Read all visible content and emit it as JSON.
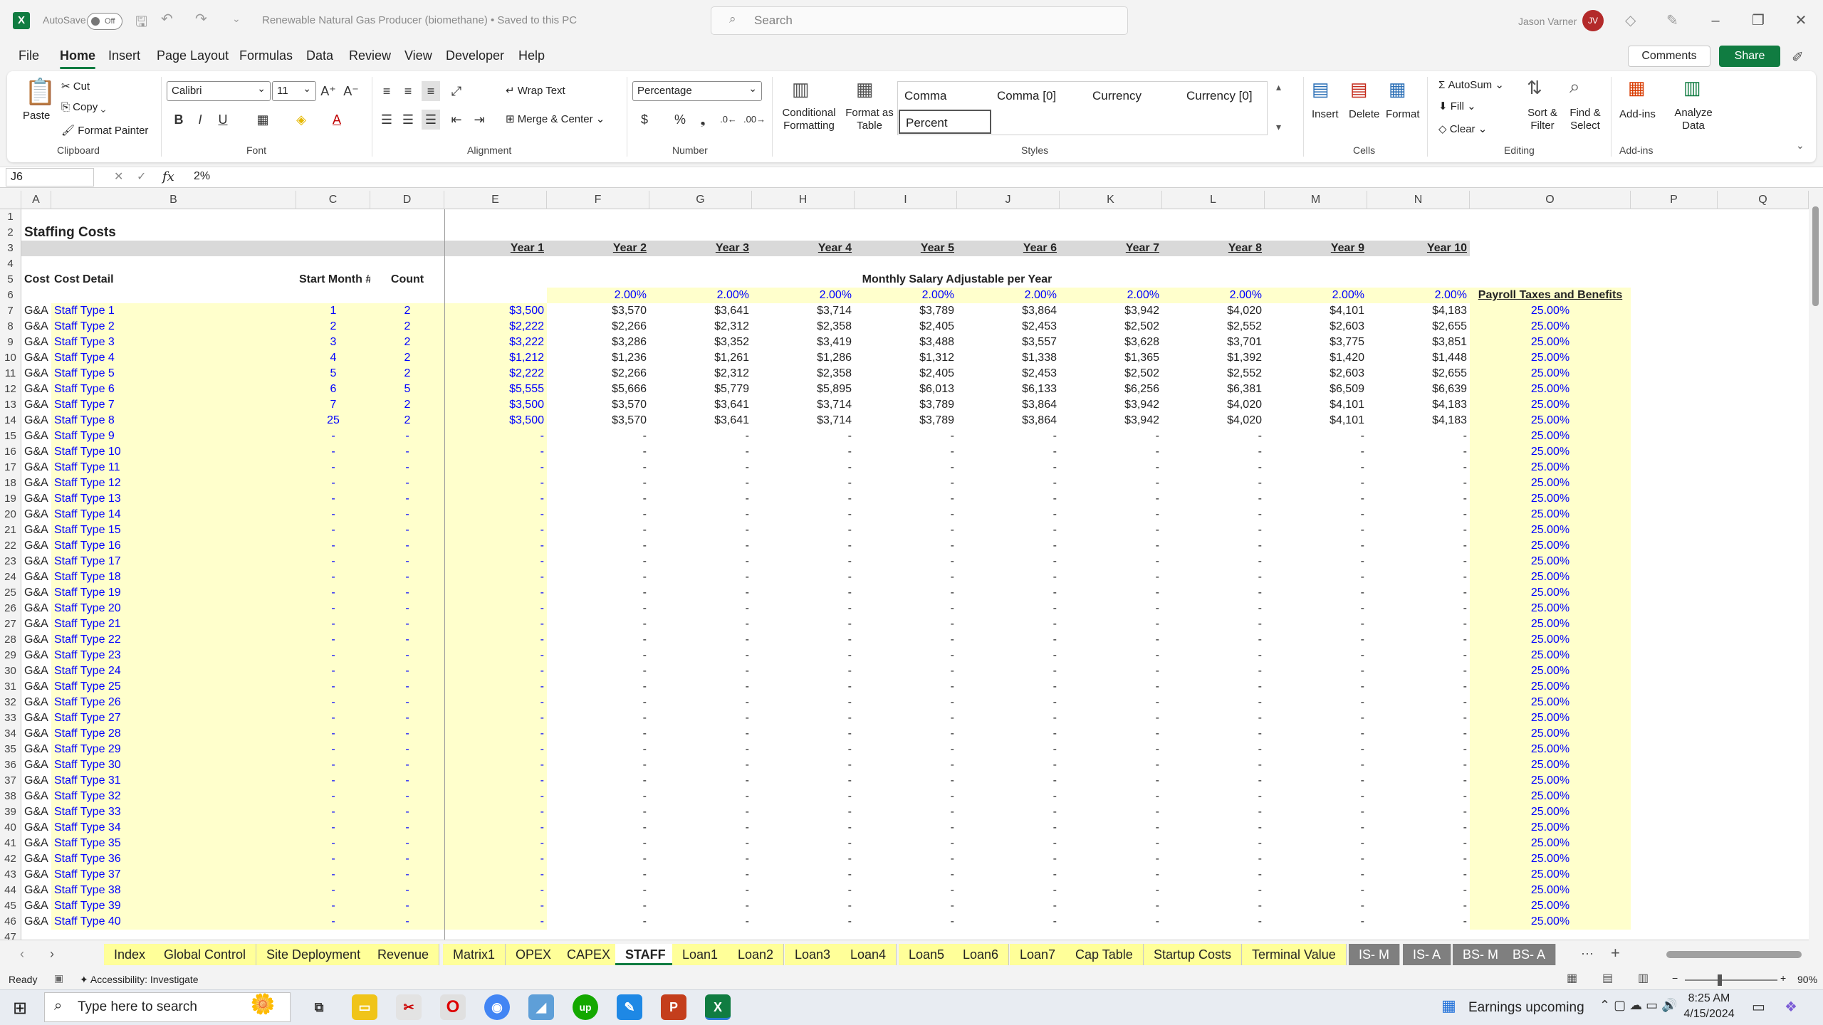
{
  "title_bar": {
    "autosave_label": "AutoSave",
    "autosave_state": "Off",
    "doc_title": "Renewable Natural Gas Producer (biomethane) • Saved to this PC",
    "search_placeholder": "Search",
    "user_name": "Jason Varner",
    "user_initials": "JV"
  },
  "menu": {
    "items": [
      "File",
      "Home",
      "Insert",
      "Page Layout",
      "Formulas",
      "Data",
      "Review",
      "View",
      "Developer",
      "Help"
    ],
    "active": "Home",
    "comments": "Comments",
    "share": "Share"
  },
  "ribbon": {
    "clipboard": {
      "paste": "Paste",
      "cut": "Cut",
      "copy": "Copy",
      "format_painter": "Format Painter",
      "label": "Clipboard"
    },
    "font": {
      "name": "Calibri",
      "size": "11",
      "label": "Font"
    },
    "alignment": {
      "wrap": "Wrap Text",
      "merge": "Merge & Center",
      "label": "Alignment"
    },
    "number": {
      "format": "Percentage",
      "label": "Number"
    },
    "styles": {
      "conditional": "Conditional Formatting",
      "format_table": "Format as Table",
      "cells": [
        "Comma",
        "Comma [0]",
        "Currency",
        "Currency [0]",
        "Percent"
      ],
      "label": "Styles"
    },
    "cells": {
      "insert": "Insert",
      "delete": "Delete",
      "format": "Format",
      "label": "Cells"
    },
    "editing": {
      "autosum": "AutoSum",
      "fill": "Fill",
      "clear": "Clear",
      "sort": "Sort & Filter",
      "find": "Find & Select",
      "label": "Editing"
    },
    "addins": {
      "addins": "Add-ins",
      "analyze": "Analyze Data",
      "label": "Add-ins"
    }
  },
  "formula_bar": {
    "name_box": "J6",
    "formula": "2%"
  },
  "columns": [
    "A",
    "B",
    "C",
    "D",
    "E",
    "F",
    "G",
    "H",
    "I",
    "J",
    "K",
    "L",
    "M",
    "N",
    "O",
    "P",
    "Q"
  ],
  "sheet": {
    "title": "Staffing Costs",
    "years": [
      "Year 1",
      "Year 2",
      "Year 3",
      "Year 4",
      "Year 5",
      "Year 6",
      "Year 7",
      "Year 8",
      "Year 9",
      "Year 10"
    ],
    "hdr_cost_type": "Cost Type",
    "hdr_cost_detail": "Cost Detail",
    "hdr_start_month": "Start Month #",
    "hdr_count": "Count",
    "hdr_salary": "Monthly Salary Adjustable per Year",
    "hdr_payroll": "Payroll Taxes and Benefits",
    "growth": "2.00%",
    "staff_rows": [
      {
        "type": "G&A",
        "detail": "Staff Type 1",
        "start": "1",
        "count": "2",
        "vals": [
          "$3,500",
          "$3,570",
          "$3,641",
          "$3,714",
          "$3,789",
          "$3,864",
          "$3,942",
          "$4,020",
          "$4,101",
          "$4,183"
        ]
      },
      {
        "type": "G&A",
        "detail": "Staff Type 2",
        "start": "2",
        "count": "2",
        "vals": [
          "$2,222",
          "$2,266",
          "$2,312",
          "$2,358",
          "$2,405",
          "$2,453",
          "$2,502",
          "$2,552",
          "$2,603",
          "$2,655"
        ]
      },
      {
        "type": "G&A",
        "detail": "Staff Type 3",
        "start": "3",
        "count": "2",
        "vals": [
          "$3,222",
          "$3,286",
          "$3,352",
          "$3,419",
          "$3,488",
          "$3,557",
          "$3,628",
          "$3,701",
          "$3,775",
          "$3,851"
        ]
      },
      {
        "type": "G&A",
        "detail": "Staff Type 4",
        "start": "4",
        "count": "2",
        "vals": [
          "$1,212",
          "$1,236",
          "$1,261",
          "$1,286",
          "$1,312",
          "$1,338",
          "$1,365",
          "$1,392",
          "$1,420",
          "$1,448"
        ]
      },
      {
        "type": "G&A",
        "detail": "Staff Type 5",
        "start": "5",
        "count": "2",
        "vals": [
          "$2,222",
          "$2,266",
          "$2,312",
          "$2,358",
          "$2,405",
          "$2,453",
          "$2,502",
          "$2,552",
          "$2,603",
          "$2,655"
        ]
      },
      {
        "type": "G&A",
        "detail": "Staff Type 6",
        "start": "6",
        "count": "5",
        "vals": [
          "$5,555",
          "$5,666",
          "$5,779",
          "$5,895",
          "$6,013",
          "$6,133",
          "$6,256",
          "$6,381",
          "$6,509",
          "$6,639"
        ]
      },
      {
        "type": "G&A",
        "detail": "Staff Type 7",
        "start": "7",
        "count": "2",
        "vals": [
          "$3,500",
          "$3,570",
          "$3,641",
          "$3,714",
          "$3,789",
          "$3,864",
          "$3,942",
          "$4,020",
          "$4,101",
          "$4,183"
        ]
      },
      {
        "type": "G&A",
        "detail": "Staff Type 8",
        "start": "25",
        "count": "2",
        "vals": [
          "$3,500",
          "$3,570",
          "$3,641",
          "$3,714",
          "$3,789",
          "$3,864",
          "$3,942",
          "$4,020",
          "$4,101",
          "$4,183"
        ]
      }
    ],
    "payroll_pct": "25.00%",
    "empty_rows": {
      "type": "G&A",
      "prefix": "Staff Type ",
      "from": 9,
      "to": 40,
      "dash": "-"
    }
  },
  "tabs": [
    "Index",
    "Global Control",
    "Site Deployment",
    "Revenue",
    "Matrix1",
    "OPEX",
    "CAPEX",
    "STAFF",
    "Loan1",
    "Loan2",
    "Loan3",
    "Loan4",
    "Loan5",
    "Loan6",
    "Loan7",
    "Cap Table",
    "Startup Costs",
    "Terminal Value",
    "IS- M",
    "IS- A",
    "BS- M",
    "BS- A"
  ],
  "active_tab": "STAFF",
  "status": {
    "ready": "Ready",
    "accessibility": "Accessibility: Investigate",
    "zoom": "90%"
  },
  "taskbar": {
    "search_placeholder": "Type here to search",
    "news": "Earnings upcoming",
    "time": "8:25 AM",
    "date": "4/15/2024"
  }
}
